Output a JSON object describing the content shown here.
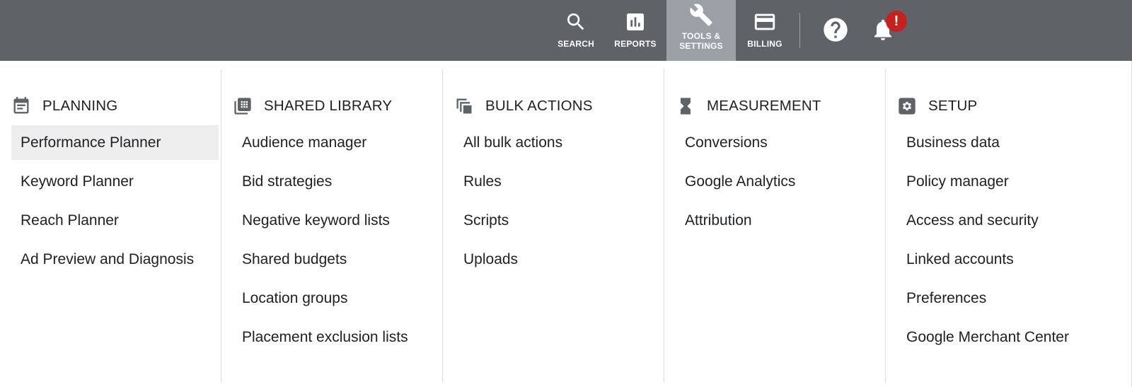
{
  "topbar": {
    "items": [
      {
        "id": "search",
        "label": "SEARCH",
        "icon": "search-icon"
      },
      {
        "id": "reports",
        "label": "REPORTS",
        "icon": "bar-chart-icon"
      },
      {
        "id": "tools",
        "label": "TOOLS &\nSETTINGS",
        "icon": "wrench-icon",
        "active": true
      },
      {
        "id": "billing",
        "label": "BILLING",
        "icon": "credit-card-icon"
      }
    ],
    "help_icon": "help-icon",
    "bell_icon": "bell-icon",
    "alert_badge": "!",
    "colors": {
      "bar": "#5f6368",
      "active": "#9aa0a6",
      "badge": "#c5221f"
    }
  },
  "menu": {
    "columns": [
      {
        "title": "PLANNING",
        "icon": "calendar-icon",
        "items": [
          "Performance Planner",
          "Keyword Planner",
          "Reach Planner",
          "Ad Preview and Diagnosis"
        ],
        "selected_index": 0
      },
      {
        "title": "SHARED LIBRARY",
        "icon": "library-icon",
        "items": [
          "Audience manager",
          "Bid strategies",
          "Negative keyword lists",
          "Shared budgets",
          "Location groups",
          "Placement exclusion lists"
        ]
      },
      {
        "title": "BULK ACTIONS",
        "icon": "copy-icon",
        "items": [
          "All bulk actions",
          "Rules",
          "Scripts",
          "Uploads"
        ]
      },
      {
        "title": "MEASUREMENT",
        "icon": "hourglass-icon",
        "items": [
          "Conversions",
          "Google Analytics",
          "Attribution"
        ]
      },
      {
        "title": "SETUP",
        "icon": "gear-icon",
        "items": [
          "Business data",
          "Policy manager",
          "Access and security",
          "Linked accounts",
          "Preferences",
          "Google Merchant Center"
        ]
      }
    ]
  }
}
